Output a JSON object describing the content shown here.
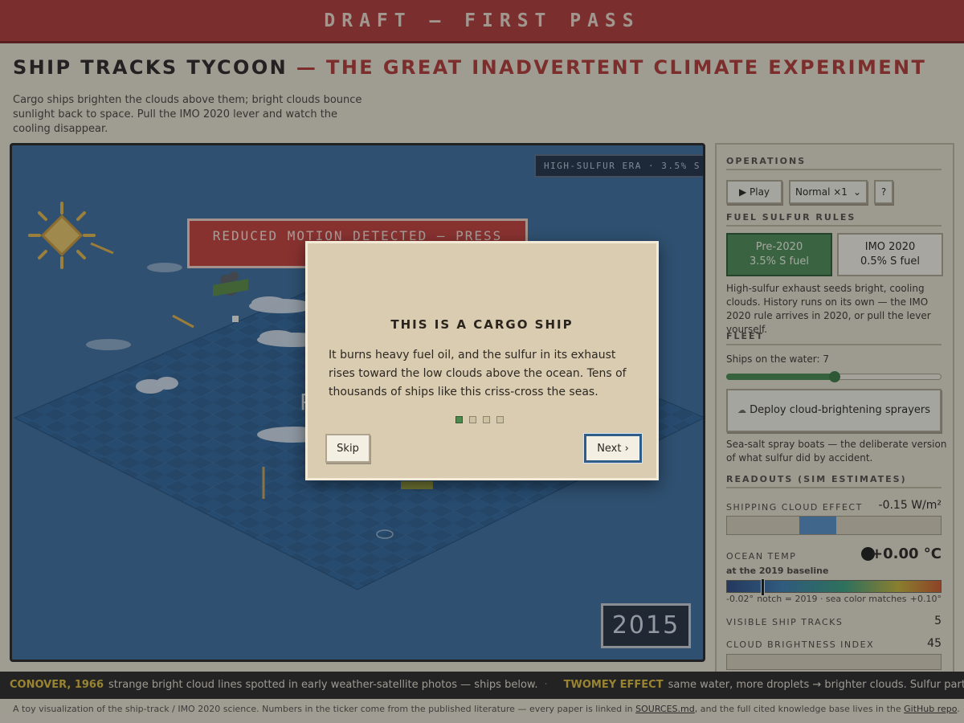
{
  "banner": "DRAFT — FIRST PASS",
  "header": {
    "title": "SHIP TRACKS TYCOON",
    "title_suffix": "— THE GREAT INADVERTENT CLIMATE EXPERIMENT",
    "subtitle": "Cargo ships brighten the clouds above them; bright clouds bounce sunlight back to space. Pull the IMO 2020 lever and watch the cooling disappear."
  },
  "game": {
    "era_badge": "HIGH-SULFUR ERA · 3.5% S",
    "reduced_motion_notice": "REDUCED MOTION DETECTED — PRESS PLAY TO",
    "year": "2015",
    "partial_text_behind_modal": "P"
  },
  "sidebar": {
    "operations_heading": "OPERATIONS",
    "play_label": "▶ Play",
    "speed_select": "Normal ×1",
    "help_label": "?",
    "fuel_heading": "FUEL SULFUR RULES",
    "fuel_options": [
      {
        "name": "Pre-2020",
        "detail": "3.5% S fuel",
        "active": true
      },
      {
        "name": "IMO 2020",
        "detail": "0.5% S fuel",
        "active": false
      }
    ],
    "fuel_note": "High-sulfur exhaust seeds bright, cooling clouds. History runs on its own — the IMO 2020 rule arrives in 2020, or pull the lever yourself.",
    "fleet_heading": "FLEET",
    "ships_label": "Ships on the water: 7",
    "ships_slider_fraction": 0.5,
    "deploy_button": "Deploy cloud-brightening sprayers",
    "deploy_icon": "cloud-icon",
    "sprayer_note": "Sea-salt spray boats — the deliberate version of what sulfur did by accident.",
    "readouts_heading": "READOUTS (SIM ESTIMATES)",
    "shipping_cloud_effect_label": "SHIPPING CLOUD EFFECT",
    "shipping_cloud_effect_value": "-0.15 W/m²",
    "ocean_temp_label": "OCEAN TEMP",
    "ocean_temp_value": "+0.00 °C",
    "ocean_temp_baseline": "at the 2019 baseline",
    "scale_min": "-0.02°",
    "scale_note": "notch = 2019 · sea color matches",
    "scale_max": "+0.10°",
    "visible_tracks_label": "VISIBLE SHIP TRACKS",
    "visible_tracks_value": "5",
    "brightness_label": "CLOUD BRIGHTNESS INDEX",
    "brightness_value": "45"
  },
  "ticker": {
    "items": [
      {
        "key": "CONOVER, 1966",
        "text": "strange bright cloud lines spotted in early weather-satellite photos — ships below."
      },
      {
        "key": "TWOMEY EFFECT",
        "text": "same water, more droplets → brighter clouds. Sulfur particles seed th"
      }
    ],
    "separator": "·"
  },
  "footer": {
    "text_before": "A toy visualization of the ship-track / IMO 2020 science. Numbers in the ticker come from the published literature — every paper is linked in ",
    "sources_link": "SOURCES.md",
    "text_middle": ", and the full cited knowledge base lives in the ",
    "repo_link": "GitHub repo",
    "text_after": "."
  },
  "tutorial": {
    "heading": "THIS IS A CARGO SHIP",
    "body": "It burns heavy fuel oil, and the sulfur in its exhaust rises toward the low clouds above the ocean. Tens of thousands of ships like this criss-cross the seas.",
    "step": 1,
    "steps_total": 4,
    "skip_label": "Skip",
    "next_label": "Next ›"
  }
}
